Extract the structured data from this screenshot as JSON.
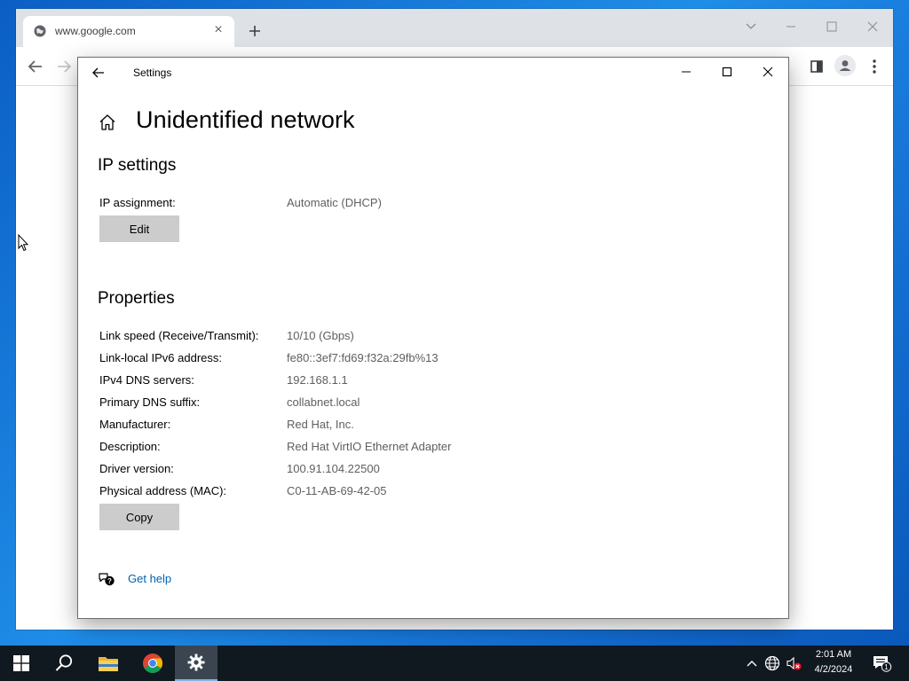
{
  "browser": {
    "tab_title": "www.google.com",
    "new_tab_symbol": "+",
    "close_tab_symbol": "×"
  },
  "settings": {
    "window_title": "Settings",
    "page_title": "Unidentified network",
    "ip_section": {
      "title": "IP settings",
      "assignment_label": "IP assignment:",
      "assignment_value": "Automatic (DHCP)",
      "edit_button": "Edit"
    },
    "properties_section": {
      "title": "Properties",
      "rows": [
        {
          "label": "Link speed (Receive/Transmit):",
          "value": "10/10 (Gbps)"
        },
        {
          "label": "Link-local IPv6 address:",
          "value": "fe80::3ef7:fd69:f32a:29fb%13"
        },
        {
          "label": "IPv4 DNS servers:",
          "value": "192.168.1.1"
        },
        {
          "label": "Primary DNS suffix:",
          "value": "collabnet.local"
        },
        {
          "label": "Manufacturer:",
          "value": "Red Hat, Inc."
        },
        {
          "label": "Description:",
          "value": "Red Hat VirtIO Ethernet Adapter"
        },
        {
          "label": "Driver version:",
          "value": "100.91.104.22500"
        },
        {
          "label": "Physical address (MAC):",
          "value": "C0-11-AB-69-42-05"
        }
      ],
      "copy_button": "Copy"
    },
    "help_link": "Get help"
  },
  "taskbar": {
    "time": "2:01 AM",
    "date": "4/2/2024",
    "notification_count": "1"
  },
  "colors": {
    "link": "#0063b1",
    "button_bg": "#cccccc",
    "taskbar_bg": "#101820"
  }
}
